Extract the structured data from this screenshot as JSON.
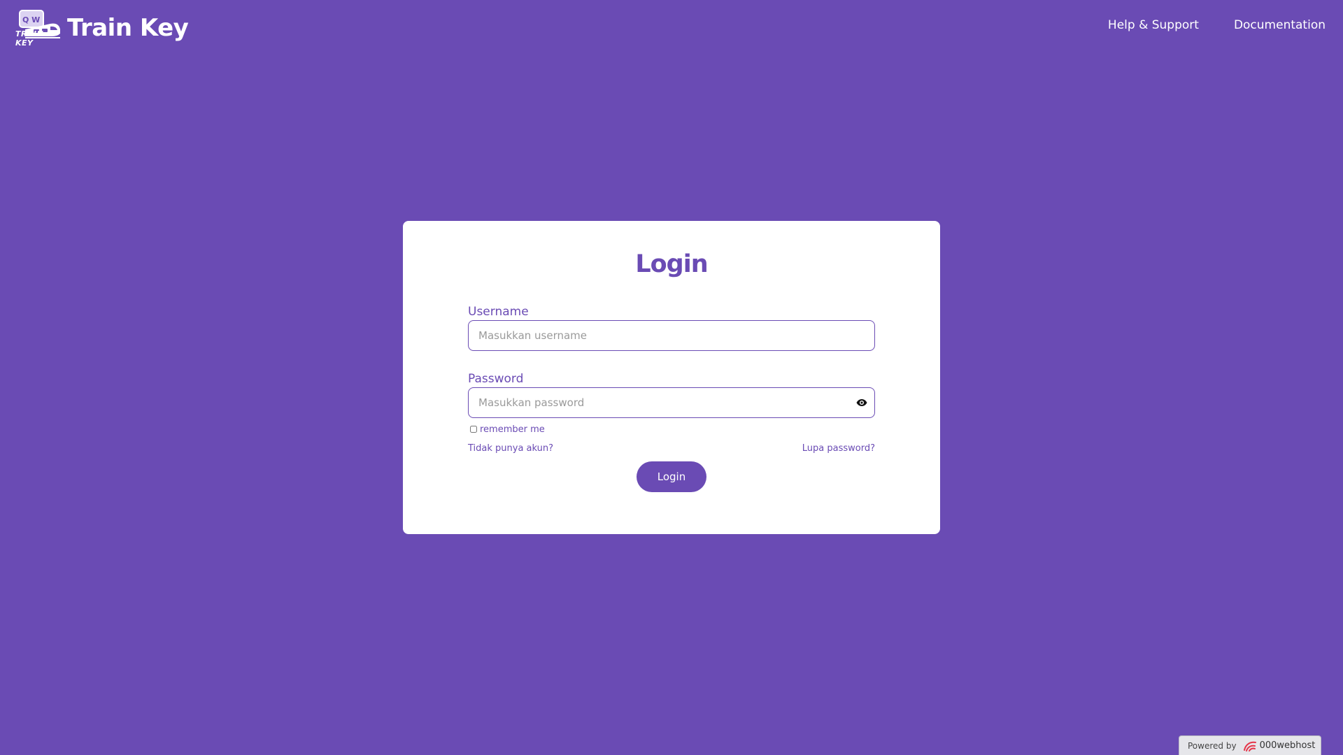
{
  "header": {
    "brand_name": "Train Key",
    "logo_text": "TRAIN KEY",
    "logo_keys": "Q W",
    "nav": [
      {
        "label": "Help & Support"
      },
      {
        "label": "Documentation"
      }
    ]
  },
  "login": {
    "title": "Login",
    "username_label": "Username",
    "username_placeholder": "Masukkan username",
    "username_value": "",
    "password_label": "Password",
    "password_placeholder": "Masukkan password",
    "password_value": "",
    "remember_label": "remember me",
    "remember_checked": false,
    "register_link": "Tidak punya akun?",
    "forgot_link": "Lupa password?",
    "submit_label": "Login"
  },
  "footer_badge": {
    "prefix": "Powered by",
    "brand": "000webhost"
  },
  "colors": {
    "background": "#6a4bb4",
    "accent": "#6a4bb4",
    "card": "#ffffff"
  },
  "icons": {
    "logo": "train-keyboard-logo-icon",
    "password_toggle": "eye-icon",
    "badge": "webhost-swirl-icon"
  }
}
